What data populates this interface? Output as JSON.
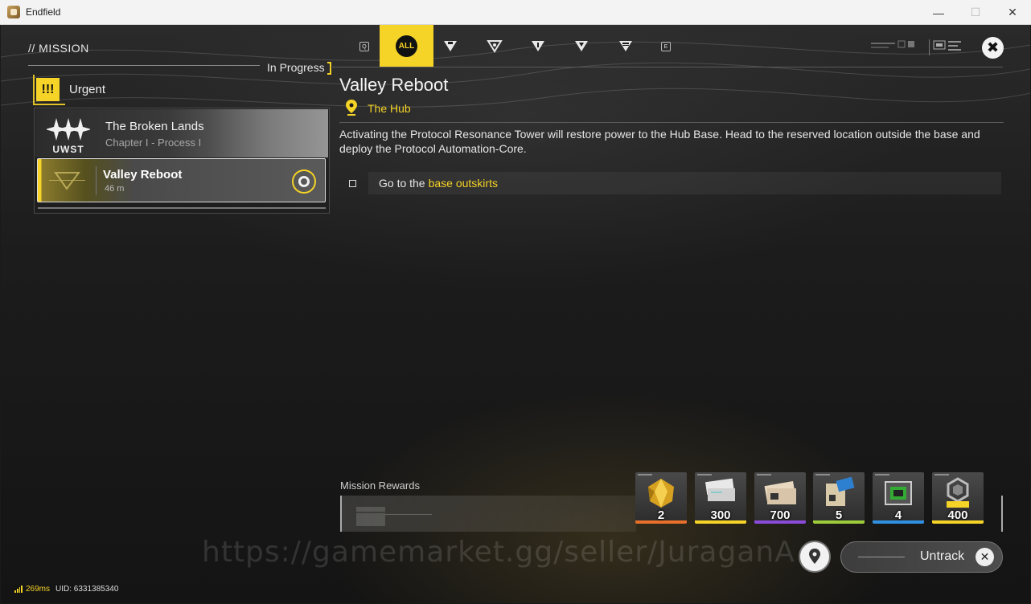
{
  "window": {
    "title": "Endfield"
  },
  "header": {
    "section": "// MISSION",
    "filter_label": "In Progress",
    "tabs": {
      "prev_key": "Q",
      "next_key": "E",
      "active": "ALL",
      "items": [
        "all",
        "category-1",
        "category-2",
        "category-3",
        "category-4",
        "category-5"
      ]
    }
  },
  "sidebar": {
    "group": {
      "icon_text": "!!!",
      "label": "Urgent"
    },
    "chapter": {
      "logo_text": "UWST",
      "title": "The Broken Lands",
      "subtitle": "Chapter I - Process I"
    },
    "quest": {
      "title": "Valley Reboot",
      "distance": "46 m"
    }
  },
  "detail": {
    "title": "Valley Reboot",
    "location": "The Hub",
    "description": "Activating the Protocol Resonance Tower will restore power to the Hub Base. Head to the reserved location outside the base and deploy the Protocol Automation-Core.",
    "objective": {
      "prefix": "Go to the",
      "highlight": "base outskirts"
    }
  },
  "rewards": {
    "label": "Mission Rewards",
    "items": [
      {
        "icon": "gold-crystal-icon",
        "count": "2",
        "rarity_color": "#e8702a"
      },
      {
        "icon": "ticket-bundle-icon",
        "count": "300",
        "rarity_color": "#f5d327"
      },
      {
        "icon": "credit-bundle-icon",
        "count": "700",
        "rarity_color": "#8a4bd8"
      },
      {
        "icon": "exp-record-icon",
        "count": "5",
        "rarity_color": "#9ccc3a"
      },
      {
        "icon": "equipment-crate-icon",
        "count": "4",
        "rarity_color": "#2f8fe0"
      },
      {
        "icon": "exp-icon",
        "count": "400",
        "rarity_color": "#f5d327"
      }
    ]
  },
  "actions": {
    "untrack_label": "Untrack"
  },
  "watermark": "https://gamemarket.gg/seller/JuraganAk",
  "footer": {
    "ping": "269ms",
    "uid": "UID: 6331385340"
  },
  "colors": {
    "accent": "#f5d327",
    "background": "#1a1a1a"
  }
}
